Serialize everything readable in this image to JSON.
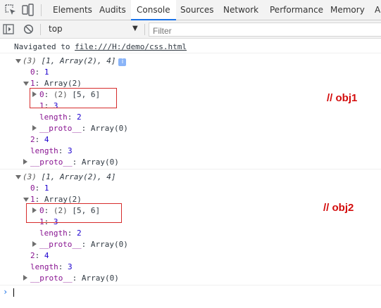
{
  "toolbar_icons": [
    "inspect-element-icon",
    "device-toolbar-icon",
    "sidebar-toggle-icon",
    "clear-console-icon",
    "dropdown-arrow-icon"
  ],
  "tabs": [
    {
      "label": "Elements",
      "active": false
    },
    {
      "label": "Audits",
      "active": false
    },
    {
      "label": "Console",
      "active": true
    },
    {
      "label": "Sources",
      "active": false
    },
    {
      "label": "Network",
      "active": false
    },
    {
      "label": "Performance",
      "active": false
    },
    {
      "label": "Memory",
      "active": false
    },
    {
      "label": "A",
      "active": false
    }
  ],
  "console_toolbar": {
    "context": "top",
    "filter_placeholder": "Filter"
  },
  "navigation": {
    "prefix": "Navigated to ",
    "url": "file:///H:/demo/css.html"
  },
  "messages": [
    {
      "summary": {
        "count": "(3)",
        "preview": "[1, Array(2), 4]",
        "info": "i"
      },
      "item0": {
        "key": "0",
        "value": "1"
      },
      "item1": {
        "key": "1",
        "label": "Array(2)"
      },
      "item1_0": {
        "key": "0",
        "count": "(2)",
        "preview": "[5, 6]"
      },
      "item1_1": {
        "key": "1",
        "value": "3"
      },
      "item1_length": {
        "key": "length",
        "value": "2"
      },
      "item1_proto": {
        "key": "__proto__",
        "value": "Array(0)"
      },
      "item2": {
        "key": "2",
        "value": "4"
      },
      "length": {
        "key": "length",
        "value": "3"
      },
      "proto": {
        "key": "__proto__",
        "value": "Array(0)"
      },
      "annotation": "// obj1"
    },
    {
      "summary": {
        "count": "(3)",
        "preview": "[1, Array(2), 4]",
        "info": "i"
      },
      "item0": {
        "key": "0",
        "value": "1"
      },
      "item1": {
        "key": "1",
        "label": "Array(2)"
      },
      "item1_0": {
        "key": "0",
        "count": "(2)",
        "preview": "[5, 6]"
      },
      "item1_1": {
        "key": "1",
        "value": "3"
      },
      "item1_length": {
        "key": "length",
        "value": "2"
      },
      "item1_proto": {
        "key": "__proto__",
        "value": "Array(0)"
      },
      "item2": {
        "key": "2",
        "value": "4"
      },
      "length": {
        "key": "length",
        "value": "3"
      },
      "proto": {
        "key": "__proto__",
        "value": "Array(0)"
      },
      "annotation": "// obj2"
    }
  ],
  "colors": {
    "active_tab_underline": "#1a73e8",
    "object_key": "#881391",
    "number": "#1c00cf",
    "annotation_red": "#d30b0b"
  }
}
